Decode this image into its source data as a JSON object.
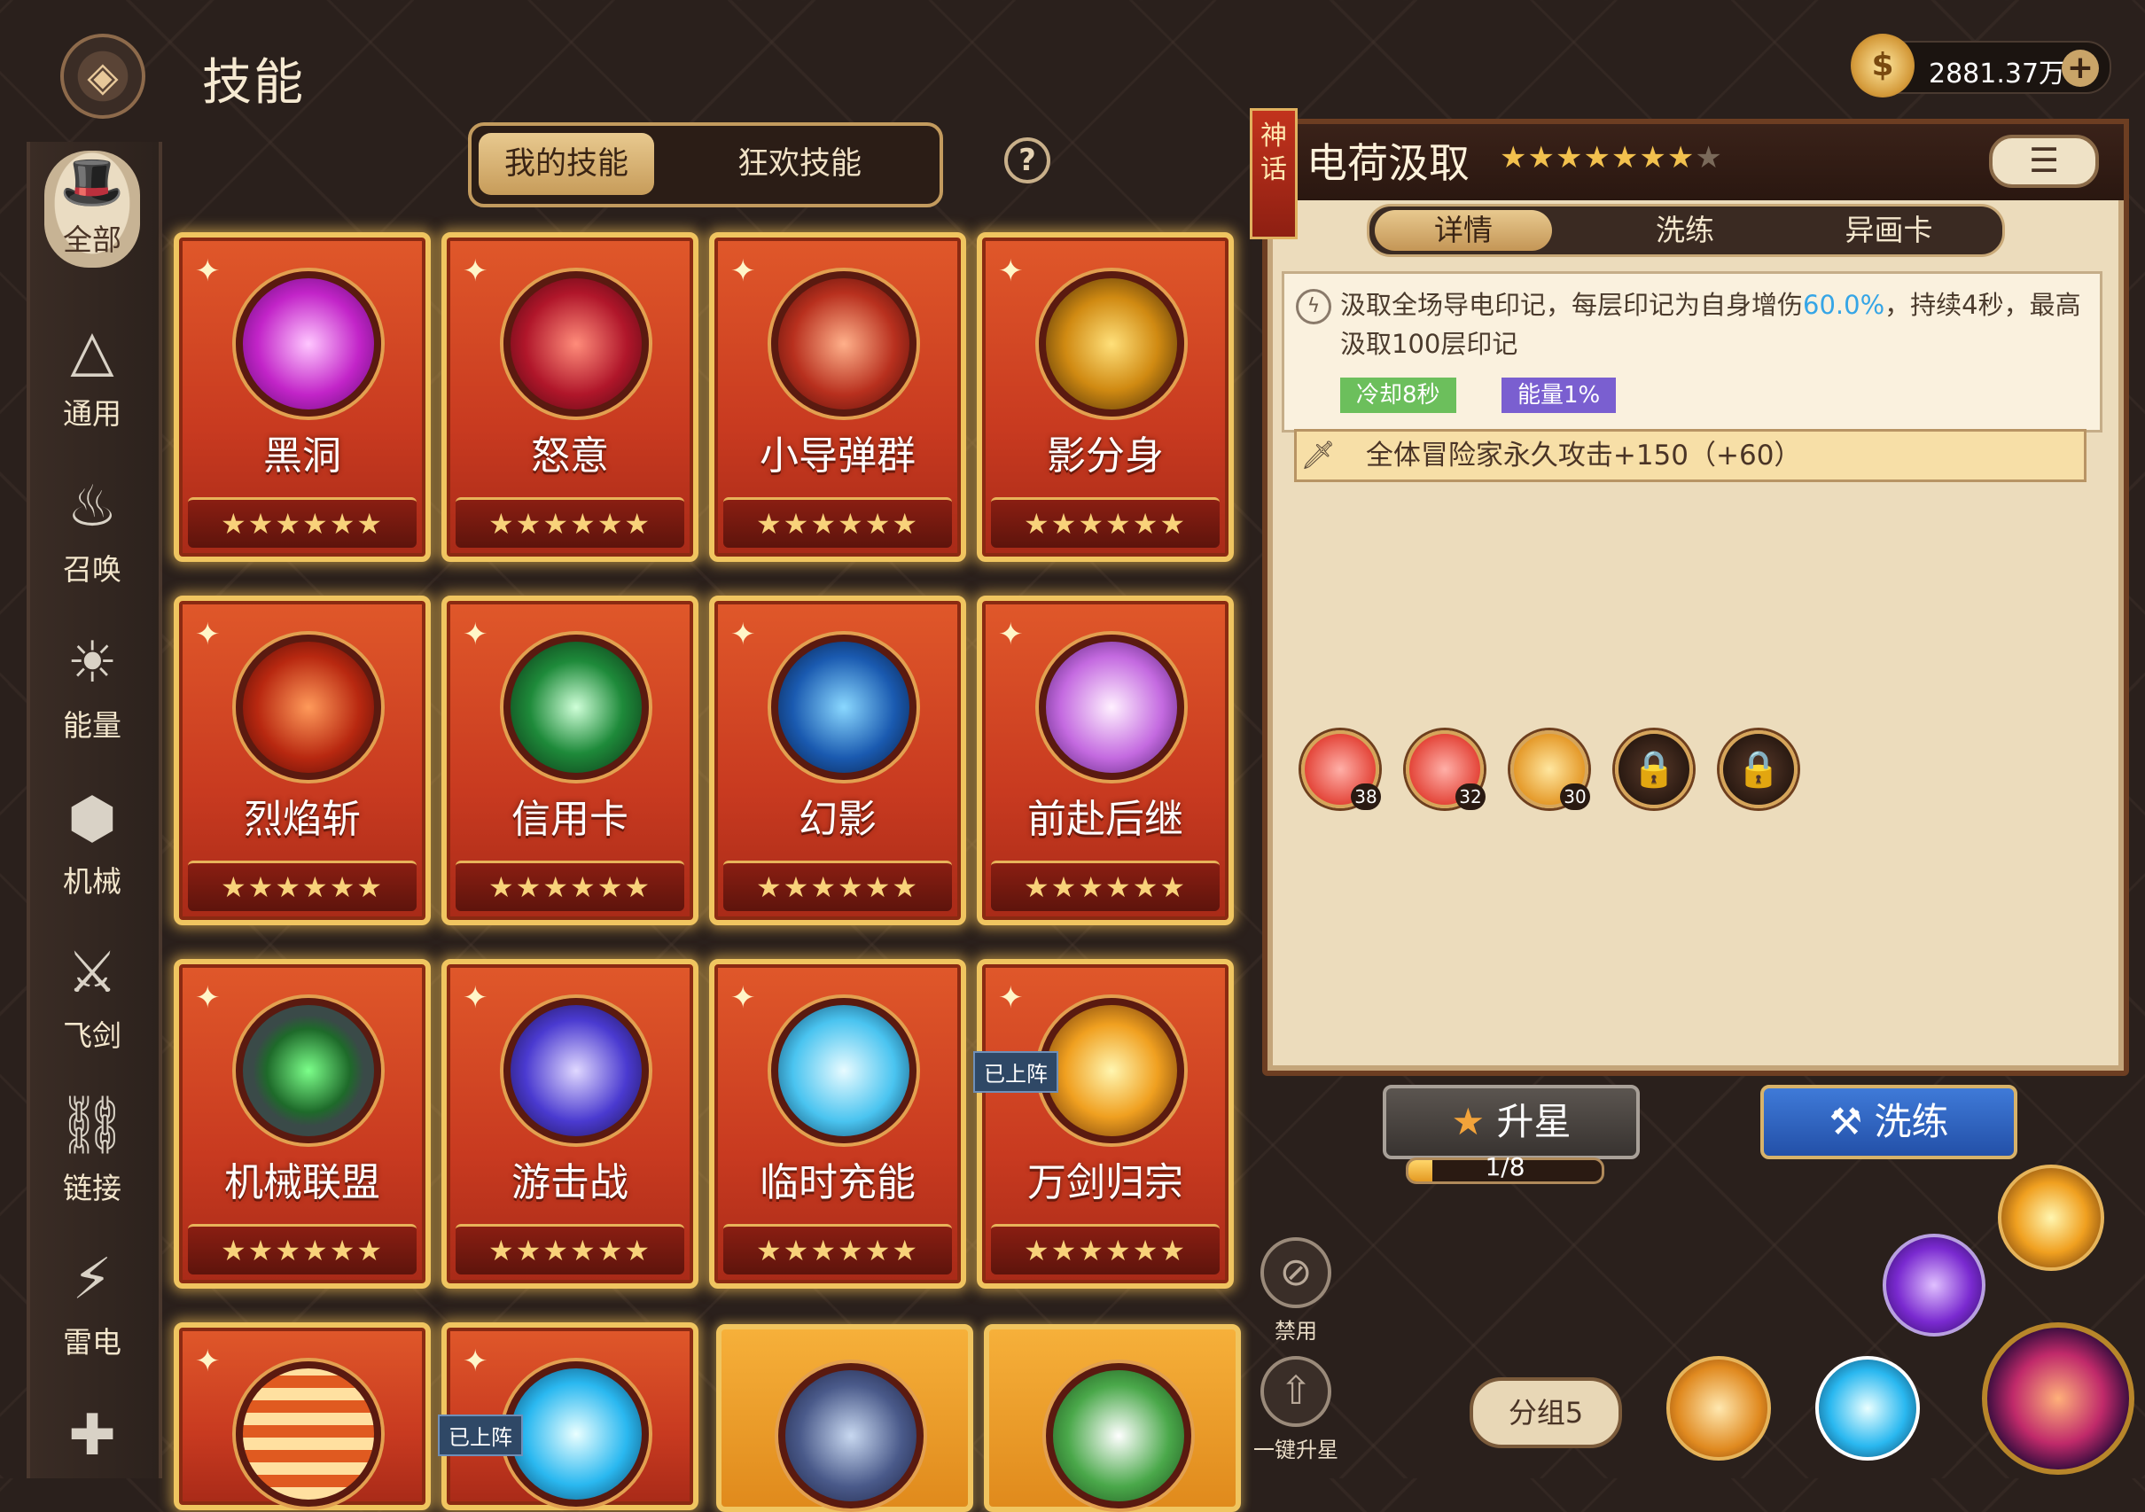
{
  "header": {
    "title": "技能",
    "back_icon": "back-diamond-icon"
  },
  "currency": {
    "amount": "2881.37万",
    "icon": "gold-coin-icon",
    "plus_label": "+"
  },
  "sidebar": {
    "items": [
      {
        "label": "全部",
        "icon": "hat-icon",
        "active": true
      },
      {
        "label": "通用",
        "icon": "triangle-rune-icon"
      },
      {
        "label": "召唤",
        "icon": "summon-flame-icon"
      },
      {
        "label": "能量",
        "icon": "energy-skull-icon"
      },
      {
        "label": "机械",
        "icon": "gear-hex-icon"
      },
      {
        "label": "飞剑",
        "icon": "flying-sword-icon"
      },
      {
        "label": "链接",
        "icon": "chain-link-icon"
      },
      {
        "label": "雷电",
        "icon": "lightning-sword-icon"
      },
      {
        "label": "",
        "icon": "cross-shield-icon"
      }
    ]
  },
  "tabs": {
    "my_skills": "我的技能",
    "carnival_skills": "狂欢技能",
    "help": "?"
  },
  "cards": [
    {
      "name": "黑洞",
      "stars": "★★★★★★",
      "orb": "purple-vortex"
    },
    {
      "name": "怒意",
      "stars": "★★★★★★",
      "orb": "red-rage"
    },
    {
      "name": "小导弹群",
      "stars": "★★★★★★",
      "orb": "missiles"
    },
    {
      "name": "影分身",
      "stars": "★★★★★★",
      "orb": "shadow-clone"
    },
    {
      "name": "烈焰斩",
      "stars": "★★★★★★",
      "orb": "flame-slash"
    },
    {
      "name": "信用卡",
      "stars": "★★★★★★",
      "orb": "green-card"
    },
    {
      "name": "幻影",
      "stars": "★★★★★★",
      "orb": "phantom-runner"
    },
    {
      "name": "前赴后继",
      "stars": "★★★★★★",
      "orb": "ghost"
    },
    {
      "name": "机械联盟",
      "stars": "★★★★★★",
      "orb": "robot-face"
    },
    {
      "name": "游击战",
      "stars": "★★★★★★",
      "orb": "guerrilla"
    },
    {
      "name": "临时充能",
      "stars": "★★★★★★",
      "orb": "crystal"
    },
    {
      "name": "万剑归宗",
      "stars": "★★★★★★",
      "orb": "sword-saint",
      "badge": "已上阵"
    }
  ],
  "partial_cards": [
    {
      "orb": "chain"
    },
    {
      "orb": "frozen-gear",
      "badge": "已上阵"
    },
    {
      "orb": "swordsman"
    },
    {
      "orb": "panda"
    }
  ],
  "detail": {
    "rarity_tag": "神话",
    "title": "电荷汲取",
    "stars": "★★★★★★★",
    "dim_star": "★",
    "menu_icon": "list-icon",
    "subtabs": [
      "详情",
      "洗练",
      "异画卡"
    ],
    "description_pre": "汲取全场导电印记，每层印记为自身增伤",
    "description_highlight": "60.0%",
    "description_post": "，持续4秒，最高汲取100层印记",
    "cooldown": "冷却8秒",
    "energy": "能量1%",
    "bonus": "全体冒险家永久攻击+150（+60）",
    "bonus_icon": "sword-icon",
    "slots": [
      {
        "level": "38",
        "type": "red"
      },
      {
        "level": "32",
        "type": "red"
      },
      {
        "level": "30",
        "type": "gold"
      },
      {
        "type": "locked"
      },
      {
        "type": "locked"
      }
    ],
    "colors": {
      "highlight": "#35a5e6",
      "cooldown": "#6cbf5c",
      "energy": "#7a5fd0"
    }
  },
  "actions": {
    "star_up": "升星",
    "progress_text": "1/8",
    "progress_fraction": 0.125,
    "refine": "洗练",
    "ban_label": "禁用",
    "one_click_label": "一键升星",
    "group_label": "分组5"
  }
}
